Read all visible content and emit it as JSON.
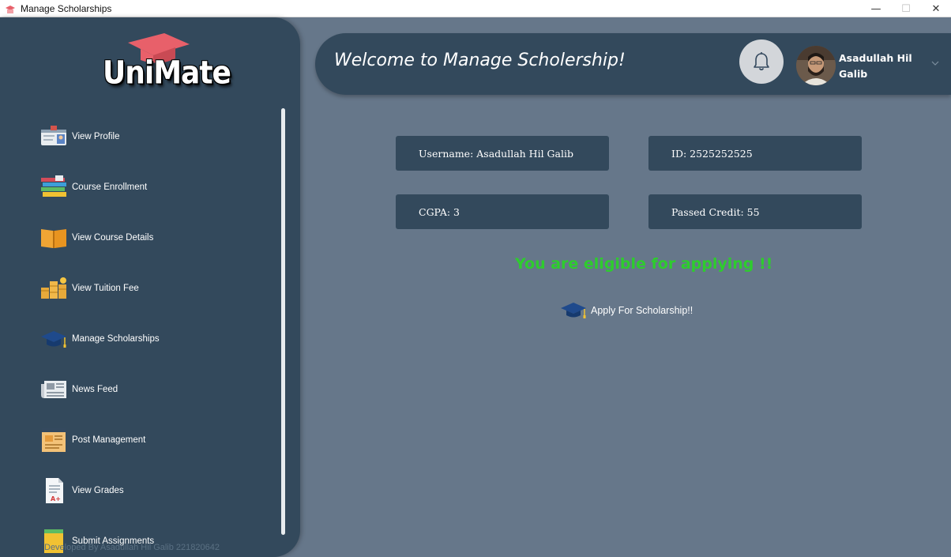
{
  "window": {
    "title": "Manage Scholarships",
    "minimize": "—",
    "maximize": "☐",
    "close": "✕"
  },
  "sidebar": {
    "logo_text": "UniMate",
    "items": [
      {
        "label": "View Profile",
        "icon": "id-card-icon"
      },
      {
        "label": "Course Enrollment",
        "icon": "books-icon"
      },
      {
        "label": "View Course Details",
        "icon": "open-book-icon"
      },
      {
        "label": "View Tuition Fee",
        "icon": "coins-icon"
      },
      {
        "label": "Manage Scholarships",
        "icon": "graduation-cap-icon"
      },
      {
        "label": "News Feed",
        "icon": "newspaper-icon"
      },
      {
        "label": "Post Management",
        "icon": "post-icon"
      },
      {
        "label": "View Grades",
        "icon": "grade-sheet-icon"
      },
      {
        "label": "Submit Assignments",
        "icon": "assignment-icon"
      }
    ],
    "footer": "Developed By Asadullah Hil Galib 221820642"
  },
  "header": {
    "title": "Welcome to Manage Scholership!",
    "user_name": "Asadullah Hil Galib"
  },
  "student": {
    "username": "Username: Asadullah Hil Galib",
    "id": "ID: 2525252525",
    "cgpa": "CGPA: 3",
    "passed_credit": "Passed Credit: 55"
  },
  "status": {
    "message": "You are eligible for applying !!",
    "color": "#2ecc2e"
  },
  "apply_button": {
    "label": "Apply For Scholarship!!"
  },
  "colors": {
    "sidebar": "#33495c",
    "main_bg": "#66778a",
    "accent_logo": "#e8606a"
  }
}
